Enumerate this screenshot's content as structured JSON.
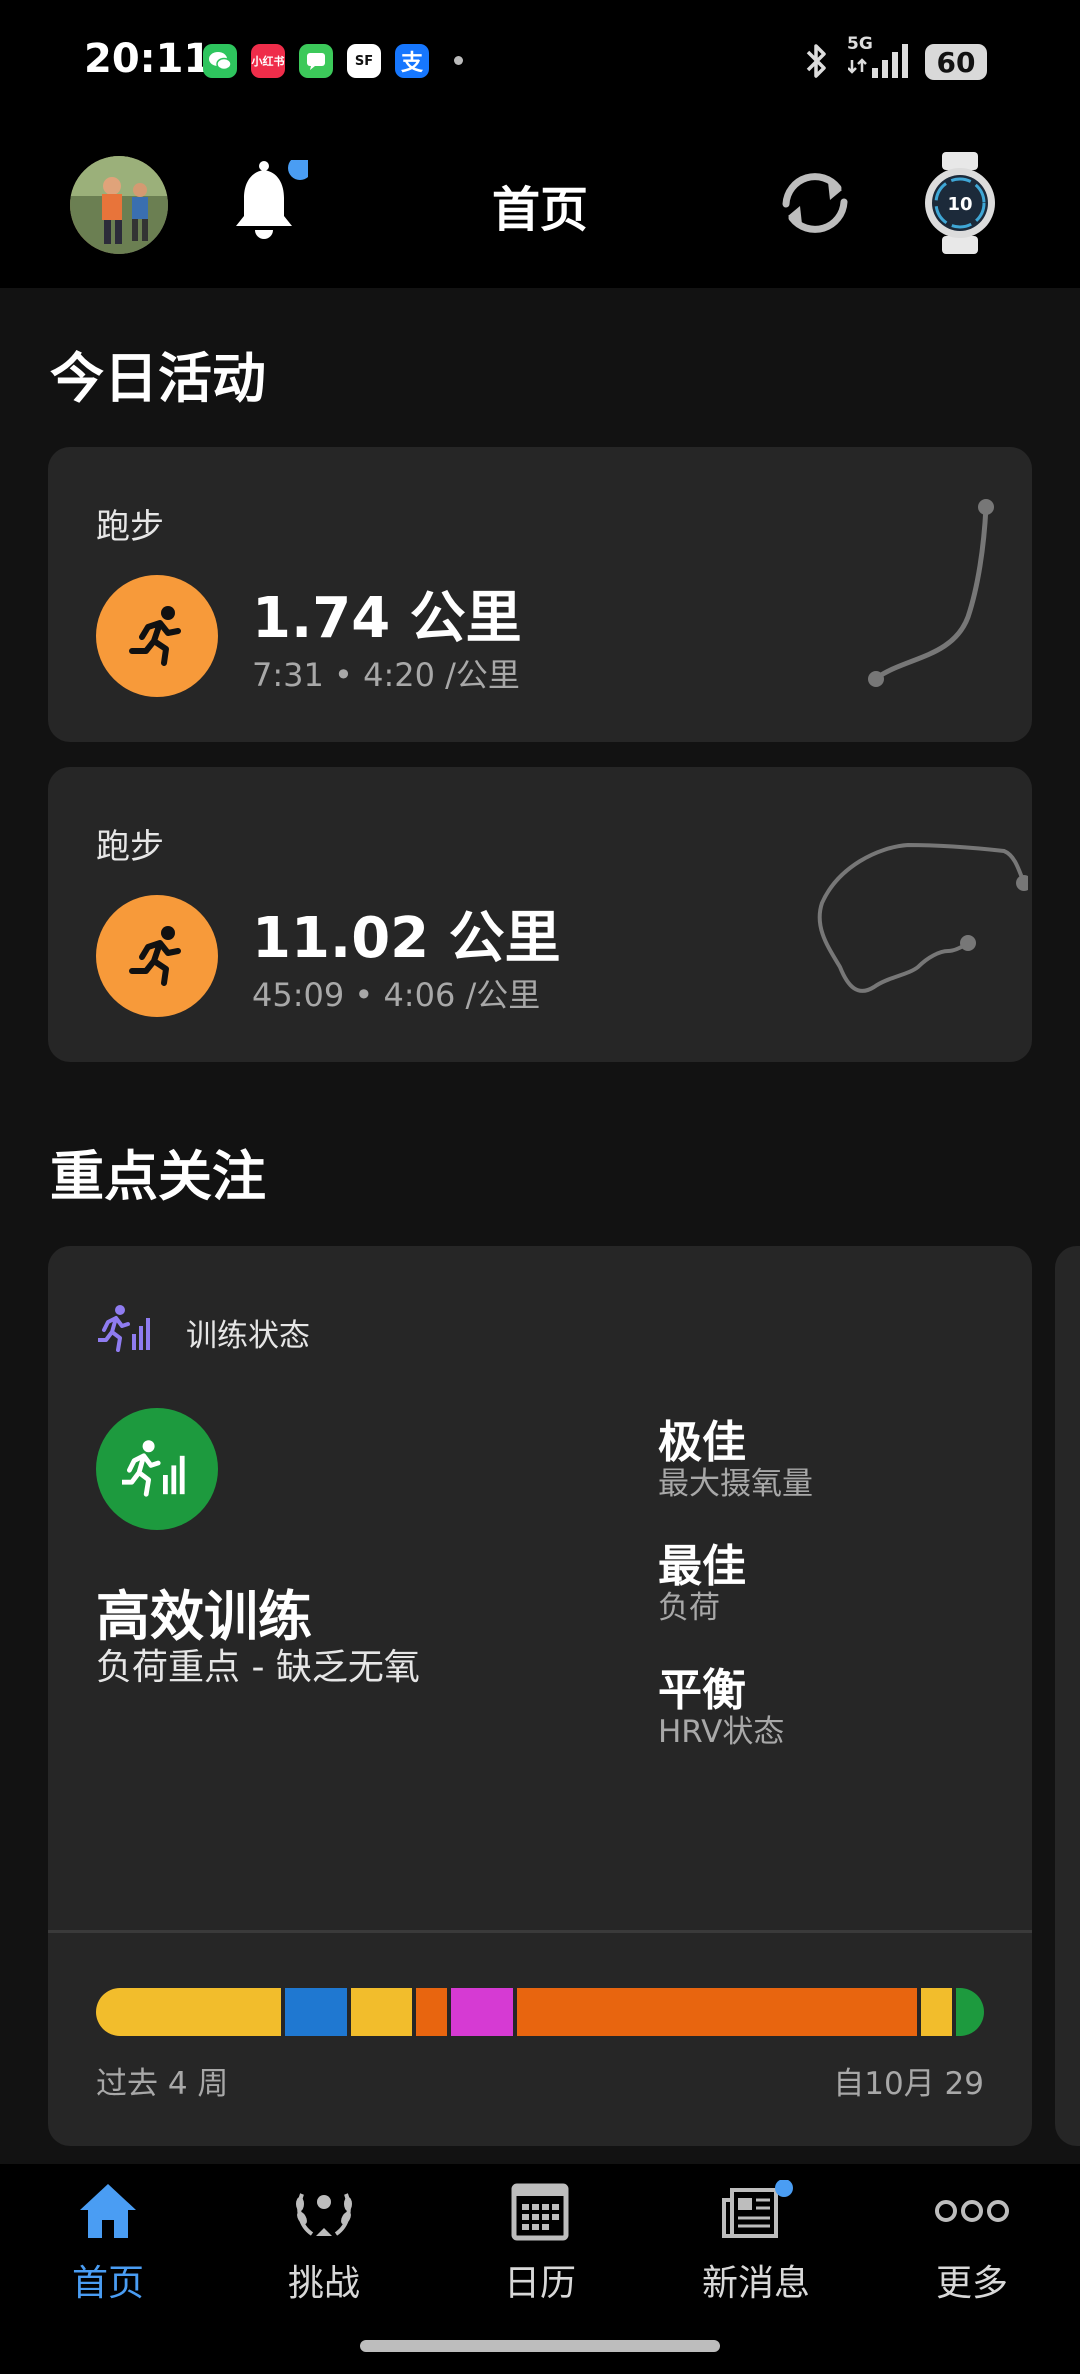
{
  "status_bar": {
    "time": "20:11",
    "apps": [
      {
        "icon": "wechat-icon",
        "text": "",
        "color": "#2ec55e"
      },
      {
        "icon": "xiaohongshu-icon",
        "text": "小红书",
        "color": "#ef2d4a"
      },
      {
        "icon": "messages-icon",
        "text": "",
        "color": "#3cc95a"
      },
      {
        "icon": "sf-express-icon",
        "text": "SF",
        "color": "#ffffff"
      },
      {
        "icon": "alipay-icon",
        "text": "支",
        "color": "#1677ff"
      }
    ],
    "network": "5G",
    "battery": "60"
  },
  "header": {
    "title": "首页"
  },
  "today": {
    "section_title": "今日活动",
    "activities": [
      {
        "type": "跑步",
        "distance": "1.74 公里",
        "detail": "7:31 • 4:20 /公里"
      },
      {
        "type": "跑步",
        "distance": "11.02 公里",
        "detail": "45:09 • 4:06 /公里"
      }
    ]
  },
  "focus": {
    "section_title": "重点关注",
    "card": {
      "label": "训练状态",
      "status": "高效训练",
      "status_sub": "负荷重点 - 缺乏无氧",
      "metrics": [
        {
          "value": "极佳",
          "label": "最大摄氧量"
        },
        {
          "value": "最佳",
          "label": "负荷"
        },
        {
          "value": "平衡",
          "label": "HRV状态"
        }
      ],
      "history_segments": [
        {
          "color": "#f2bd2c",
          "weight": 120
        },
        {
          "color": "#1f78d1",
          "weight": 40
        },
        {
          "color": "#f2bd2c",
          "weight": 40
        },
        {
          "color": "#e8650f",
          "weight": 20
        },
        {
          "color": "#d63ad3",
          "weight": 40
        },
        {
          "color": "#e8650f",
          "weight": 260
        },
        {
          "color": "#f2bd2c",
          "weight": 20
        },
        {
          "color": "#1d9a3e",
          "weight": 18
        }
      ],
      "left_caption": "过去 4 周",
      "right_caption": "自10月 29"
    }
  },
  "bottom_nav": [
    {
      "icon": "home-icon",
      "label": "首页",
      "active": true
    },
    {
      "icon": "laurel-icon",
      "label": "挑战",
      "active": false
    },
    {
      "icon": "calendar-icon",
      "label": "日历",
      "active": false
    },
    {
      "icon": "newsfeed-icon",
      "label": "新消息",
      "active": false
    },
    {
      "icon": "more-icon",
      "label": "更多",
      "active": false
    }
  ],
  "colors": {
    "accent": "#4a9df3",
    "run": "#f79a3a",
    "status_green": "#1d9a3e",
    "purple": "#8f7cf0"
  }
}
